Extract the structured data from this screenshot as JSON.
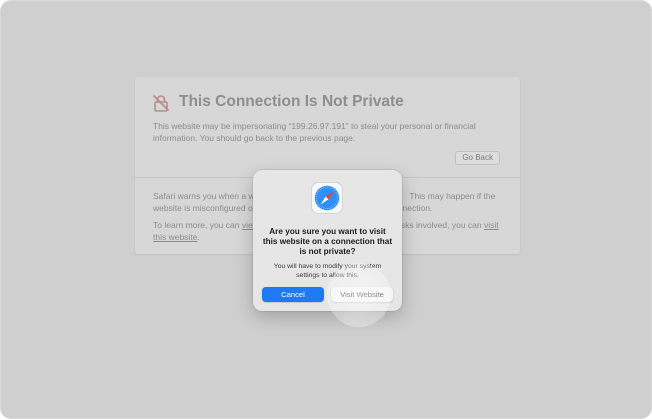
{
  "warning": {
    "title": "This Connection Is Not Private",
    "body": "This website may be impersonating “199.26.97.191” to steal your personal or financial information. You should go back to the previous page.",
    "go_back_label": "Go Back",
    "para1_a": "Safari warns you when a we",
    "para1_b": "This may happen if the",
    "para1_c": "website is misconfigured or",
    "para1_d": "nection.",
    "para2_a": "To learn more, you can ",
    "para2_link1": "view",
    "para2_b": "sks involved, you can ",
    "para2_link2a": "visit",
    "para2_link2b": "this website",
    "para2_end": ".",
    "icon": "lock-slash-icon",
    "title_color": "#8e8e8e"
  },
  "dialog": {
    "icon": "safari-compass-icon",
    "title": "Are you sure you want to visit this website on a connection that is not private?",
    "message": "You will have to modify your system settings to allow this.",
    "cancel_label": "Cancel",
    "visit_label": "Visit Website",
    "accent_color": "#1e7af2"
  }
}
